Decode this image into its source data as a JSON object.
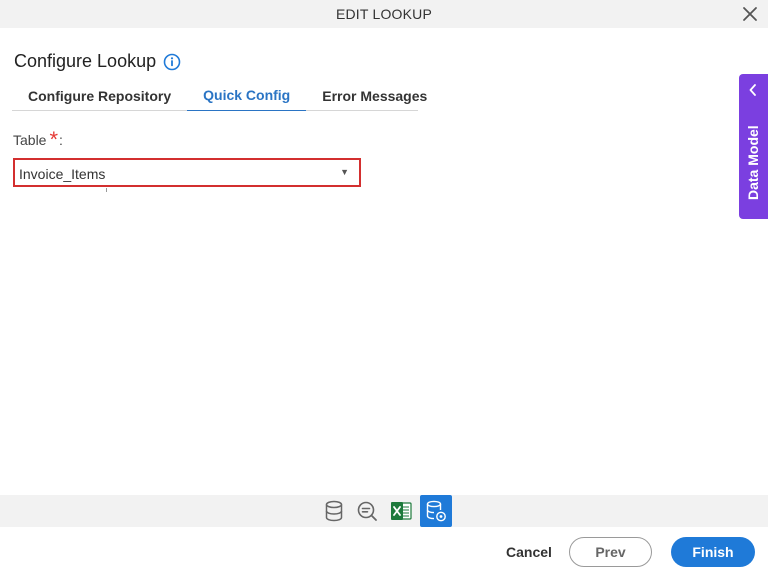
{
  "window": {
    "title": "EDIT LOOKUP",
    "close_icon": "close-icon"
  },
  "page": {
    "heading": "Configure Lookup",
    "info_icon": "info-icon"
  },
  "tabs": [
    {
      "label": "Configure Repository",
      "active": false
    },
    {
      "label": "Quick Config",
      "active": true
    },
    {
      "label": "Error Messages",
      "active": false
    }
  ],
  "form": {
    "table_label": "Table",
    "required_mark": "*",
    "colon": ":",
    "table_value": "Invoice_Items",
    "dropdown_arrow": "▼"
  },
  "side_panel": {
    "label": "Data Model",
    "icon": "chevron-left-icon"
  },
  "toolbar_icons": [
    {
      "name": "database-icon",
      "active": false
    },
    {
      "name": "search-minus-icon",
      "active": false
    },
    {
      "name": "excel-icon",
      "active": false
    },
    {
      "name": "database-settings-icon",
      "active": true
    }
  ],
  "footer": {
    "cancel_label": "Cancel",
    "prev_label": "Prev",
    "finish_label": "Finish"
  },
  "colors": {
    "accent": "#1f7ad8",
    "tab_active": "#2a74c4",
    "error_border": "#d32f2f",
    "required": "#e53935",
    "side_panel": "#7b3fe0"
  }
}
